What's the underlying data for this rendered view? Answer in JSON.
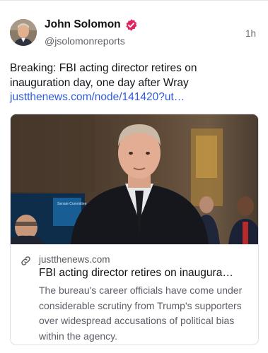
{
  "post": {
    "author_name": "John Solomon",
    "author_handle": "@jsolomonreports",
    "time": "1h",
    "verified_badge_color": "#e0245e",
    "text": "Breaking: FBI acting director retires on inauguration day, one day after Wray",
    "link_text": "justthenews.com/node/141420?ut…",
    "link_color": "#2f5bd8"
  },
  "card": {
    "domain": "justthenews.com",
    "title": "FBI acting director retires on inaugura…",
    "description": "The bureau's career officials have come under considerable scrutiny from Trump's supporters over widespread accusations of political bias within the agency.",
    "screen_text": "Senate Committee"
  },
  "icons": {
    "avatar": "avatar",
    "verified": "verified-badge-icon",
    "link": "link-icon"
  }
}
